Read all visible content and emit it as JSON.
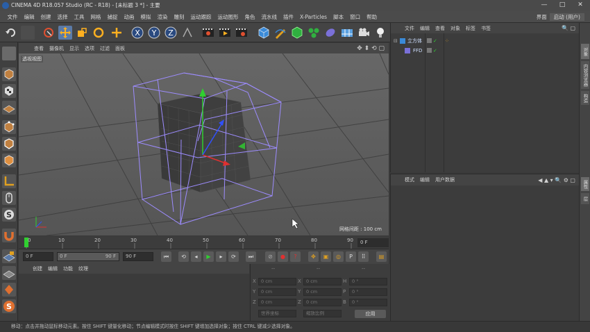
{
  "window": {
    "title": "CINEMA 4D R18.057 Studio (RC - R18) - [未标题 3 *] - 主要",
    "min": "—",
    "max": "□",
    "close": "✕"
  },
  "menu": [
    "文件",
    "编辑",
    "创建",
    "选择",
    "工具",
    "网格",
    "捕捉",
    "动画",
    "模拟",
    "渲染",
    "雕刻",
    "运动跟踪",
    "运动图形",
    "角色",
    "流水线",
    "插件",
    "X-Particles",
    "脚本",
    "窗口",
    "帮助"
  ],
  "layout_tabs": {
    "layout_label": "界面",
    "layout_value": "启动 (用户)"
  },
  "viewport": {
    "menu": [
      "查看",
      "摄像机",
      "显示",
      "选项",
      "过滤",
      "面板"
    ],
    "label": "透视视图",
    "grid_spacing": "网格间距 : 100 cm"
  },
  "timeline": {
    "ticks": [
      "0",
      "10",
      "20",
      "30",
      "40",
      "50",
      "60",
      "70",
      "80",
      "90"
    ],
    "current_frame": "0 F"
  },
  "transport": {
    "start": "0 F",
    "range_start": "0 F",
    "range_end": "90 F",
    "end": "90 F"
  },
  "material": {
    "menu": [
      "创建",
      "编辑",
      "功能",
      "纹理"
    ]
  },
  "coordinates": {
    "header": [
      "--",
      "--",
      "--"
    ],
    "rows": [
      {
        "a": "X",
        "av": "0 cm",
        "b": "X",
        "bv": "0 cm",
        "c": "H",
        "cv": "0 °"
      },
      {
        "a": "Y",
        "av": "0 cm",
        "b": "Y",
        "bv": "0 cm",
        "c": "P",
        "cv": "0 °"
      },
      {
        "a": "Z",
        "av": "0 cm",
        "b": "Z",
        "bv": "0 cm",
        "c": "B",
        "cv": "0 °"
      }
    ],
    "mode1": "世界坐标",
    "mode2": "缩放比例",
    "apply": "应用"
  },
  "objects": {
    "menu": [
      "文件",
      "编辑",
      "查看",
      "对象",
      "标签",
      "书签"
    ],
    "items": [
      {
        "name": "立方体"
      },
      {
        "name": "FFD"
      }
    ]
  },
  "attributes": {
    "menu": [
      "模式",
      "编辑",
      "用户数据"
    ]
  },
  "right_tabs": [
    "对象",
    "内容浏览器",
    "构造",
    "属性",
    "层"
  ],
  "status": "移动：点击并拖动鼠标移动元素。按住 SHIFT 键量化移动；节点编辑模式时按住 SHIFT 键增加选择对象；按住 CTRL 键减少选择对象。",
  "colors": {
    "accent": "#5b7ba8",
    "lattice": "#9d8cff",
    "axis_x": "#e03030",
    "axis_y": "#30d030",
    "axis_z": "#3050ff"
  }
}
